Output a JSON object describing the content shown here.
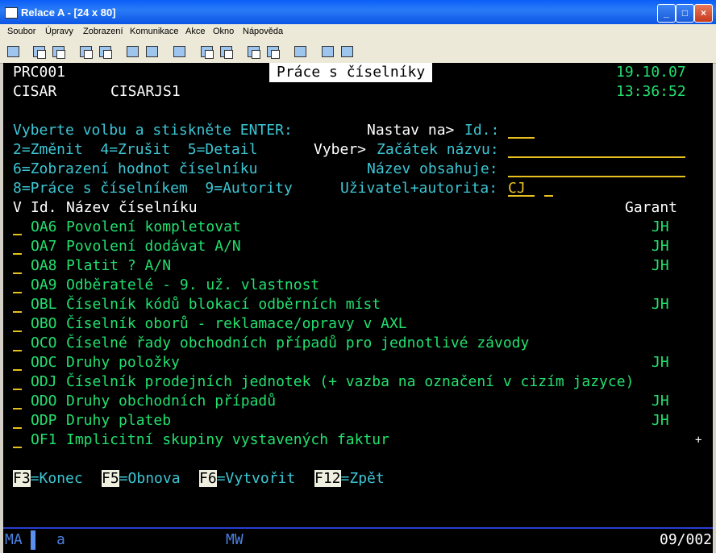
{
  "window": {
    "title": "Relace A - [24 x 80]"
  },
  "menu": [
    "Soubor",
    "Úpravy",
    "Zobrazení",
    "Komunikace",
    "Akce",
    "Okno",
    "Nápověda"
  ],
  "screen": {
    "program": "PRC001",
    "title": "Práce s číselníky",
    "date": "19.10.07",
    "user": "CISAR",
    "device": "CISARJS1",
    "time": "13:36:52",
    "instruction": "Vyberte volbu a stiskněte ENTER:",
    "options_1": "2=Změnit  4=Zrušit  5=Detail",
    "options_2": "6=Zobrazení hodnot číselníku",
    "options_3": "8=Práce s číselníkem  9=Autority",
    "nastav_label": "Nastav na>",
    "id_label": "Id.:",
    "id_value": "",
    "vyber_label": "Vyber>",
    "zacatek_label": "Začátek názvu:",
    "zacatek_value": "",
    "obsahuje_label": "Název obsahuje:",
    "obsahuje_value": "",
    "uzivatel_label": "Uživatel+autorita:",
    "uzivatel_value": "CJ",
    "autorita_value": "",
    "col_v": "V",
    "col_id": "Id.",
    "col_name": "Název číselníku",
    "col_garant": "Garant",
    "more": "+",
    "fkeys": [
      {
        "key": "F3",
        "label": "=Konec"
      },
      {
        "key": "F5",
        "label": "=Obnova"
      },
      {
        "key": "F6",
        "label": "=Vytvořit"
      },
      {
        "key": "F12",
        "label": "=Zpět"
      }
    ]
  },
  "rows": [
    {
      "id": "OA6",
      "name": "Povolení kompletovat",
      "garant": "JH"
    },
    {
      "id": "OA7",
      "name": "Povolení dodávat A/N",
      "garant": "JH"
    },
    {
      "id": "OA8",
      "name": "Platit ? A/N",
      "garant": "JH"
    },
    {
      "id": "OA9",
      "name": "Odběratelé - 9. už. vlastnost",
      "garant": ""
    },
    {
      "id": "OBL",
      "name": "Číselník kódů blokací odběrních míst",
      "garant": "JH"
    },
    {
      "id": "OBO",
      "name": "Číselník oborů - reklamace/opravy v AXL",
      "garant": ""
    },
    {
      "id": "OCO",
      "name": "Číselné řady obchodních případů pro jednotlivé závody",
      "garant": ""
    },
    {
      "id": "ODC",
      "name": "Druhy položky",
      "garant": "JH"
    },
    {
      "id": "ODJ",
      "name": "Číselník prodejních jednotek (+ vazba na označení v cizím jazyce)",
      "garant": ""
    },
    {
      "id": "ODO",
      "name": "Druhy obchodních případů",
      "garant": "JH"
    },
    {
      "id": "ODP",
      "name": "Druhy plateb",
      "garant": "JH"
    },
    {
      "id": "OF1",
      "name": "Implicitní skupiny vystavených faktur",
      "garant": ""
    }
  ],
  "status": {
    "mode": "MA",
    "session": "a",
    "mw": "MW",
    "cursor": "09/002"
  }
}
